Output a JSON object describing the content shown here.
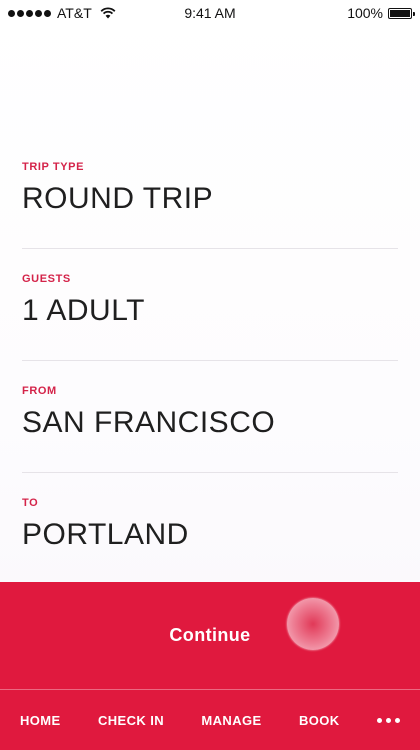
{
  "status_bar": {
    "carrier": "AT&T",
    "time": "9:41 AM",
    "battery": "100%"
  },
  "form": {
    "fields": [
      {
        "label": "TRIP TYPE",
        "value": "ROUND TRIP"
      },
      {
        "label": "GUESTS",
        "value": "1 ADULT"
      },
      {
        "label": "FROM",
        "value": "SAN FRANCISCO"
      },
      {
        "label": "TO",
        "value": "PORTLAND"
      }
    ]
  },
  "continue_label": "Continue",
  "nav": {
    "items": [
      "HOME",
      "CHECK IN",
      "MANAGE",
      "BOOK"
    ],
    "more_icon": "more-dots-icon"
  },
  "colors": {
    "accent": "#e0193e",
    "label": "#d42349"
  }
}
